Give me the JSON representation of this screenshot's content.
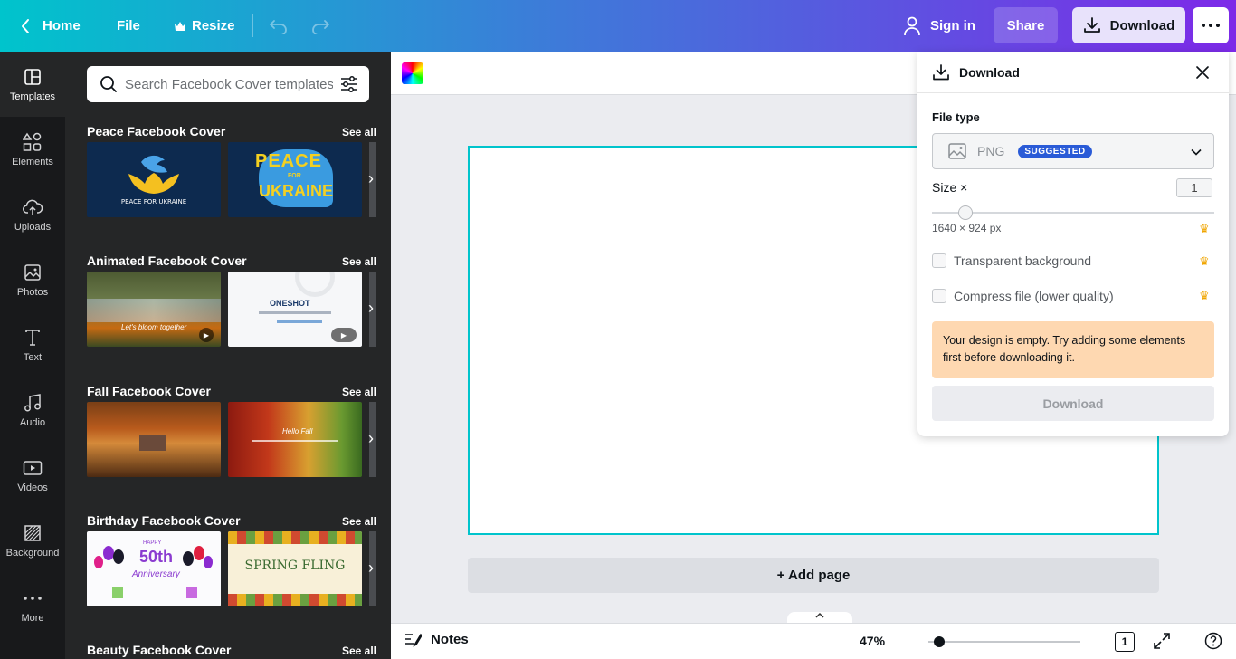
{
  "header": {
    "home_label": "Home",
    "file_label": "File",
    "resize_label": "Resize",
    "sign_in_label": "Sign in",
    "share_label": "Share",
    "download_label": "Download"
  },
  "rail": {
    "items": [
      {
        "label": "Templates",
        "icon": "templates-icon"
      },
      {
        "label": "Elements",
        "icon": "elements-icon"
      },
      {
        "label": "Uploads",
        "icon": "upload-icon"
      },
      {
        "label": "Photos",
        "icon": "photos-icon"
      },
      {
        "label": "Text",
        "icon": "text-icon"
      },
      {
        "label": "Audio",
        "icon": "audio-icon"
      },
      {
        "label": "Videos",
        "icon": "videos-icon"
      },
      {
        "label": "Background",
        "icon": "background-icon"
      },
      {
        "label": "More",
        "icon": "more-icon"
      }
    ]
  },
  "panel": {
    "search_placeholder": "Search Facebook Cover templates",
    "see_all": "See all",
    "sections": [
      {
        "title": "Peace Facebook Cover",
        "thumb1_text": "PEACE FOR UKRAINE",
        "thumb2_text": "PEACE",
        "thumb2_sub": "FOR",
        "thumb2_text2": "UKRAINE"
      },
      {
        "title": "Animated Facebook Cover",
        "thumb1_text": "Let's bloom together",
        "thumb2_text": "ONESHOT"
      },
      {
        "title": "Fall Facebook Cover",
        "thumb2_text": "Hello Fall"
      },
      {
        "title": "Birthday Facebook Cover",
        "thumb1_text": "50th",
        "thumb1_sub": "Anniversary",
        "thumb1_top": "HAPPY",
        "thumb2_text": "SPRING FLING"
      },
      {
        "title": "Beauty Facebook Cover"
      }
    ]
  },
  "canvas": {
    "add_page_label": "+ Add page"
  },
  "bottombar": {
    "notes_label": "Notes",
    "zoom": "47%",
    "page_count": "1"
  },
  "download_panel": {
    "title": "Download",
    "file_type_label": "File type",
    "file_type_value": "PNG",
    "suggested_badge": "SUGGESTED",
    "size_label": "Size ×",
    "size_value": "1",
    "size_slider": 0.12,
    "dimensions": "1640 × 924 px",
    "transparent_label": "Transparent background",
    "compress_label": "Compress file (lower quality)",
    "warning": "Your design is empty. Try adding some elements first before downloading it.",
    "download_button": "Download"
  },
  "colors": {
    "accent": "#00c4cc",
    "purple": "#7d2ae8",
    "warning_bg": "#fed8b1",
    "crown": "#f0a500"
  }
}
